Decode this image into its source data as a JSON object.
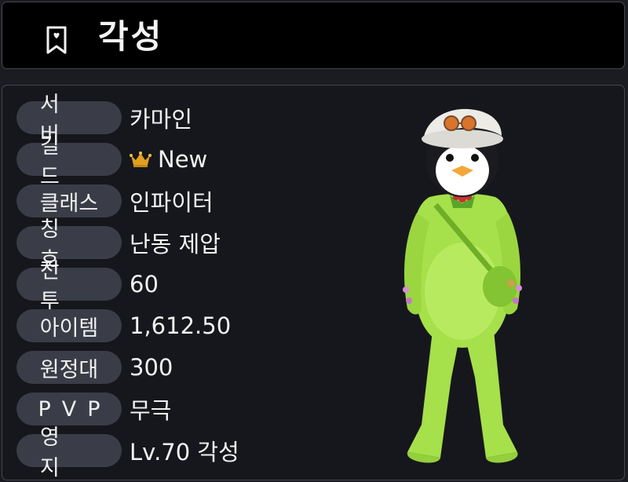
{
  "header": {
    "icon": "bookmark-icon",
    "title": "각성"
  },
  "profile": {
    "rows": [
      {
        "label": "서버",
        "value": "카마인"
      },
      {
        "label": "길드",
        "value": "New",
        "icon": "crown-icon"
      },
      {
        "label": "클래스",
        "value": "인파이터"
      },
      {
        "label": "칭호",
        "value": "난동 제압"
      },
      {
        "label": "전투",
        "value": "60"
      },
      {
        "label": "아이템",
        "value": "1,612.50"
      },
      {
        "label": "원정대",
        "value": "300"
      },
      {
        "label": "PVP",
        "value": "무극"
      },
      {
        "label": "영지",
        "value": "Lv.70 각성"
      }
    ]
  },
  "colors": {
    "background": "#1b1c22",
    "pill": "#3a3d48",
    "crown": "#e0a020",
    "avatar_body": "#a6e04a"
  }
}
